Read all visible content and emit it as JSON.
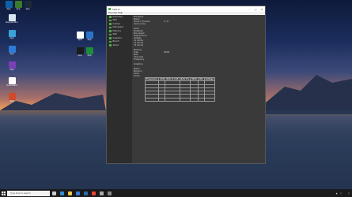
{
  "colors": {
    "accent_green": "#4caf50",
    "window_bg": "#3a3a3a",
    "taskbar_bg": "#1b1b1b"
  },
  "desktop": {
    "icons": [
      {
        "label": "Recycle Bin",
        "icon": "recycle-bin-icon",
        "color": "#d8e4f0"
      },
      {
        "label": "App",
        "icon": "app-icon",
        "color": "#3aa0d8"
      },
      {
        "label": "App",
        "icon": "app-icon",
        "color": "#2e7bd6"
      },
      {
        "label": "App",
        "icon": "app-icon",
        "color": "#7b3fb8"
      },
      {
        "label": "Document",
        "icon": "document-icon",
        "color": "#ffffff"
      },
      {
        "label": "App",
        "icon": "app-icon",
        "color": "#d24a2a"
      },
      {
        "label": "App",
        "icon": "app-icon",
        "color": "#ffffff"
      },
      {
        "label": "App",
        "icon": "app-icon",
        "color": "#2b73c8"
      },
      {
        "label": "App",
        "icon": "app-icon",
        "color": "#1b1b1b"
      },
      {
        "label": "App",
        "icon": "app-icon",
        "color": "#1e8c3a"
      },
      {
        "label": "App",
        "icon": "app-icon",
        "color": "#0f5fa8"
      },
      {
        "label": "App",
        "icon": "app-icon",
        "color": "#3b7a2a"
      },
      {
        "label": "App",
        "icon": "app-icon",
        "color": "#1b2838"
      }
    ]
  },
  "window": {
    "title": "CPU-Z",
    "menu": "File  View  Help",
    "sidebar": [
      "Summary",
      "CPU",
      "Caches",
      "Mainboard",
      "Memory",
      "SPD",
      "Graphics",
      "Bench",
      "About"
    ],
    "summary": [
      {
        "k": "Processor",
        "v": ""
      },
      {
        "k": "  Name",
        "v": ""
      },
      {
        "k": "  Cores / Threads",
        "v": "4 / 8"
      },
      {
        "k": "  Code name",
        "v": ""
      },
      {
        "k": "",
        "v": ""
      },
      {
        "k": "  Clock",
        "v": ""
      },
      {
        "k": "  Multiplier",
        "v": ""
      },
      {
        "k": "  Bus speed",
        "v": ""
      },
      {
        "k": "  Temperature",
        "v": ""
      },
      {
        "k": "  Voltage",
        "v": ""
      },
      {
        "k": "  L1 Cache",
        "v": ""
      },
      {
        "k": "  L2 Cache",
        "v": ""
      },
      {
        "k": "  L3 Cache",
        "v": ""
      },
      {
        "k": "",
        "v": ""
      },
      {
        "k": "Memory",
        "v": ""
      },
      {
        "k": "  Type",
        "v": "DDR4"
      },
      {
        "k": "  Size",
        "v": ""
      },
      {
        "k": "  Channels",
        "v": ""
      },
      {
        "k": "  Frequency",
        "v": ""
      },
      {
        "k": "",
        "v": ""
      },
      {
        "k": "Graphics",
        "v": ""
      },
      {
        "k": "",
        "v": ""
      },
      {
        "k": "  Name",
        "v": ""
      },
      {
        "k": "  Memory",
        "v": ""
      },
      {
        "k": "  Clock",
        "v": ""
      },
      {
        "k": "  Driver",
        "v": ""
      }
    ],
    "mem_table": {
      "headers": [
        "Frequency",
        "CAS",
        "RAS to CAS",
        "RAS Pre",
        "tRAS",
        "tRC",
        "Voltage"
      ],
      "rows": [
        [
          "",
          "",
          "",
          "",
          "",
          "",
          ""
        ],
        [
          "",
          "",
          "",
          "",
          "",
          "",
          ""
        ],
        [
          "",
          "",
          "",
          "",
          "",
          "",
          ""
        ],
        [
          "",
          "",
          "",
          "",
          "",
          "",
          ""
        ],
        [
          "",
          "",
          "",
          "",
          "",
          "",
          ""
        ],
        [
          "",
          "",
          "",
          "",
          "",
          "",
          ""
        ]
      ]
    },
    "footer": []
  },
  "taskbar": {
    "search_placeholder": "Type here to search",
    "apps": [
      {
        "name": "task-view-icon",
        "color": "#cccccc"
      },
      {
        "name": "edge-icon",
        "color": "#2f8fd8"
      },
      {
        "name": "explorer-icon",
        "color": "#f2c94c"
      },
      {
        "name": "store-icon",
        "color": "#3a7bd5"
      },
      {
        "name": "mail-icon",
        "color": "#2b6cb0"
      },
      {
        "name": "chrome-icon",
        "color": "#e8453c"
      },
      {
        "name": "app-icon",
        "color": "#aaaaaa"
      },
      {
        "name": "app-icon",
        "color": "#888888"
      }
    ],
    "tray_time": "",
    "tray_date": ""
  }
}
